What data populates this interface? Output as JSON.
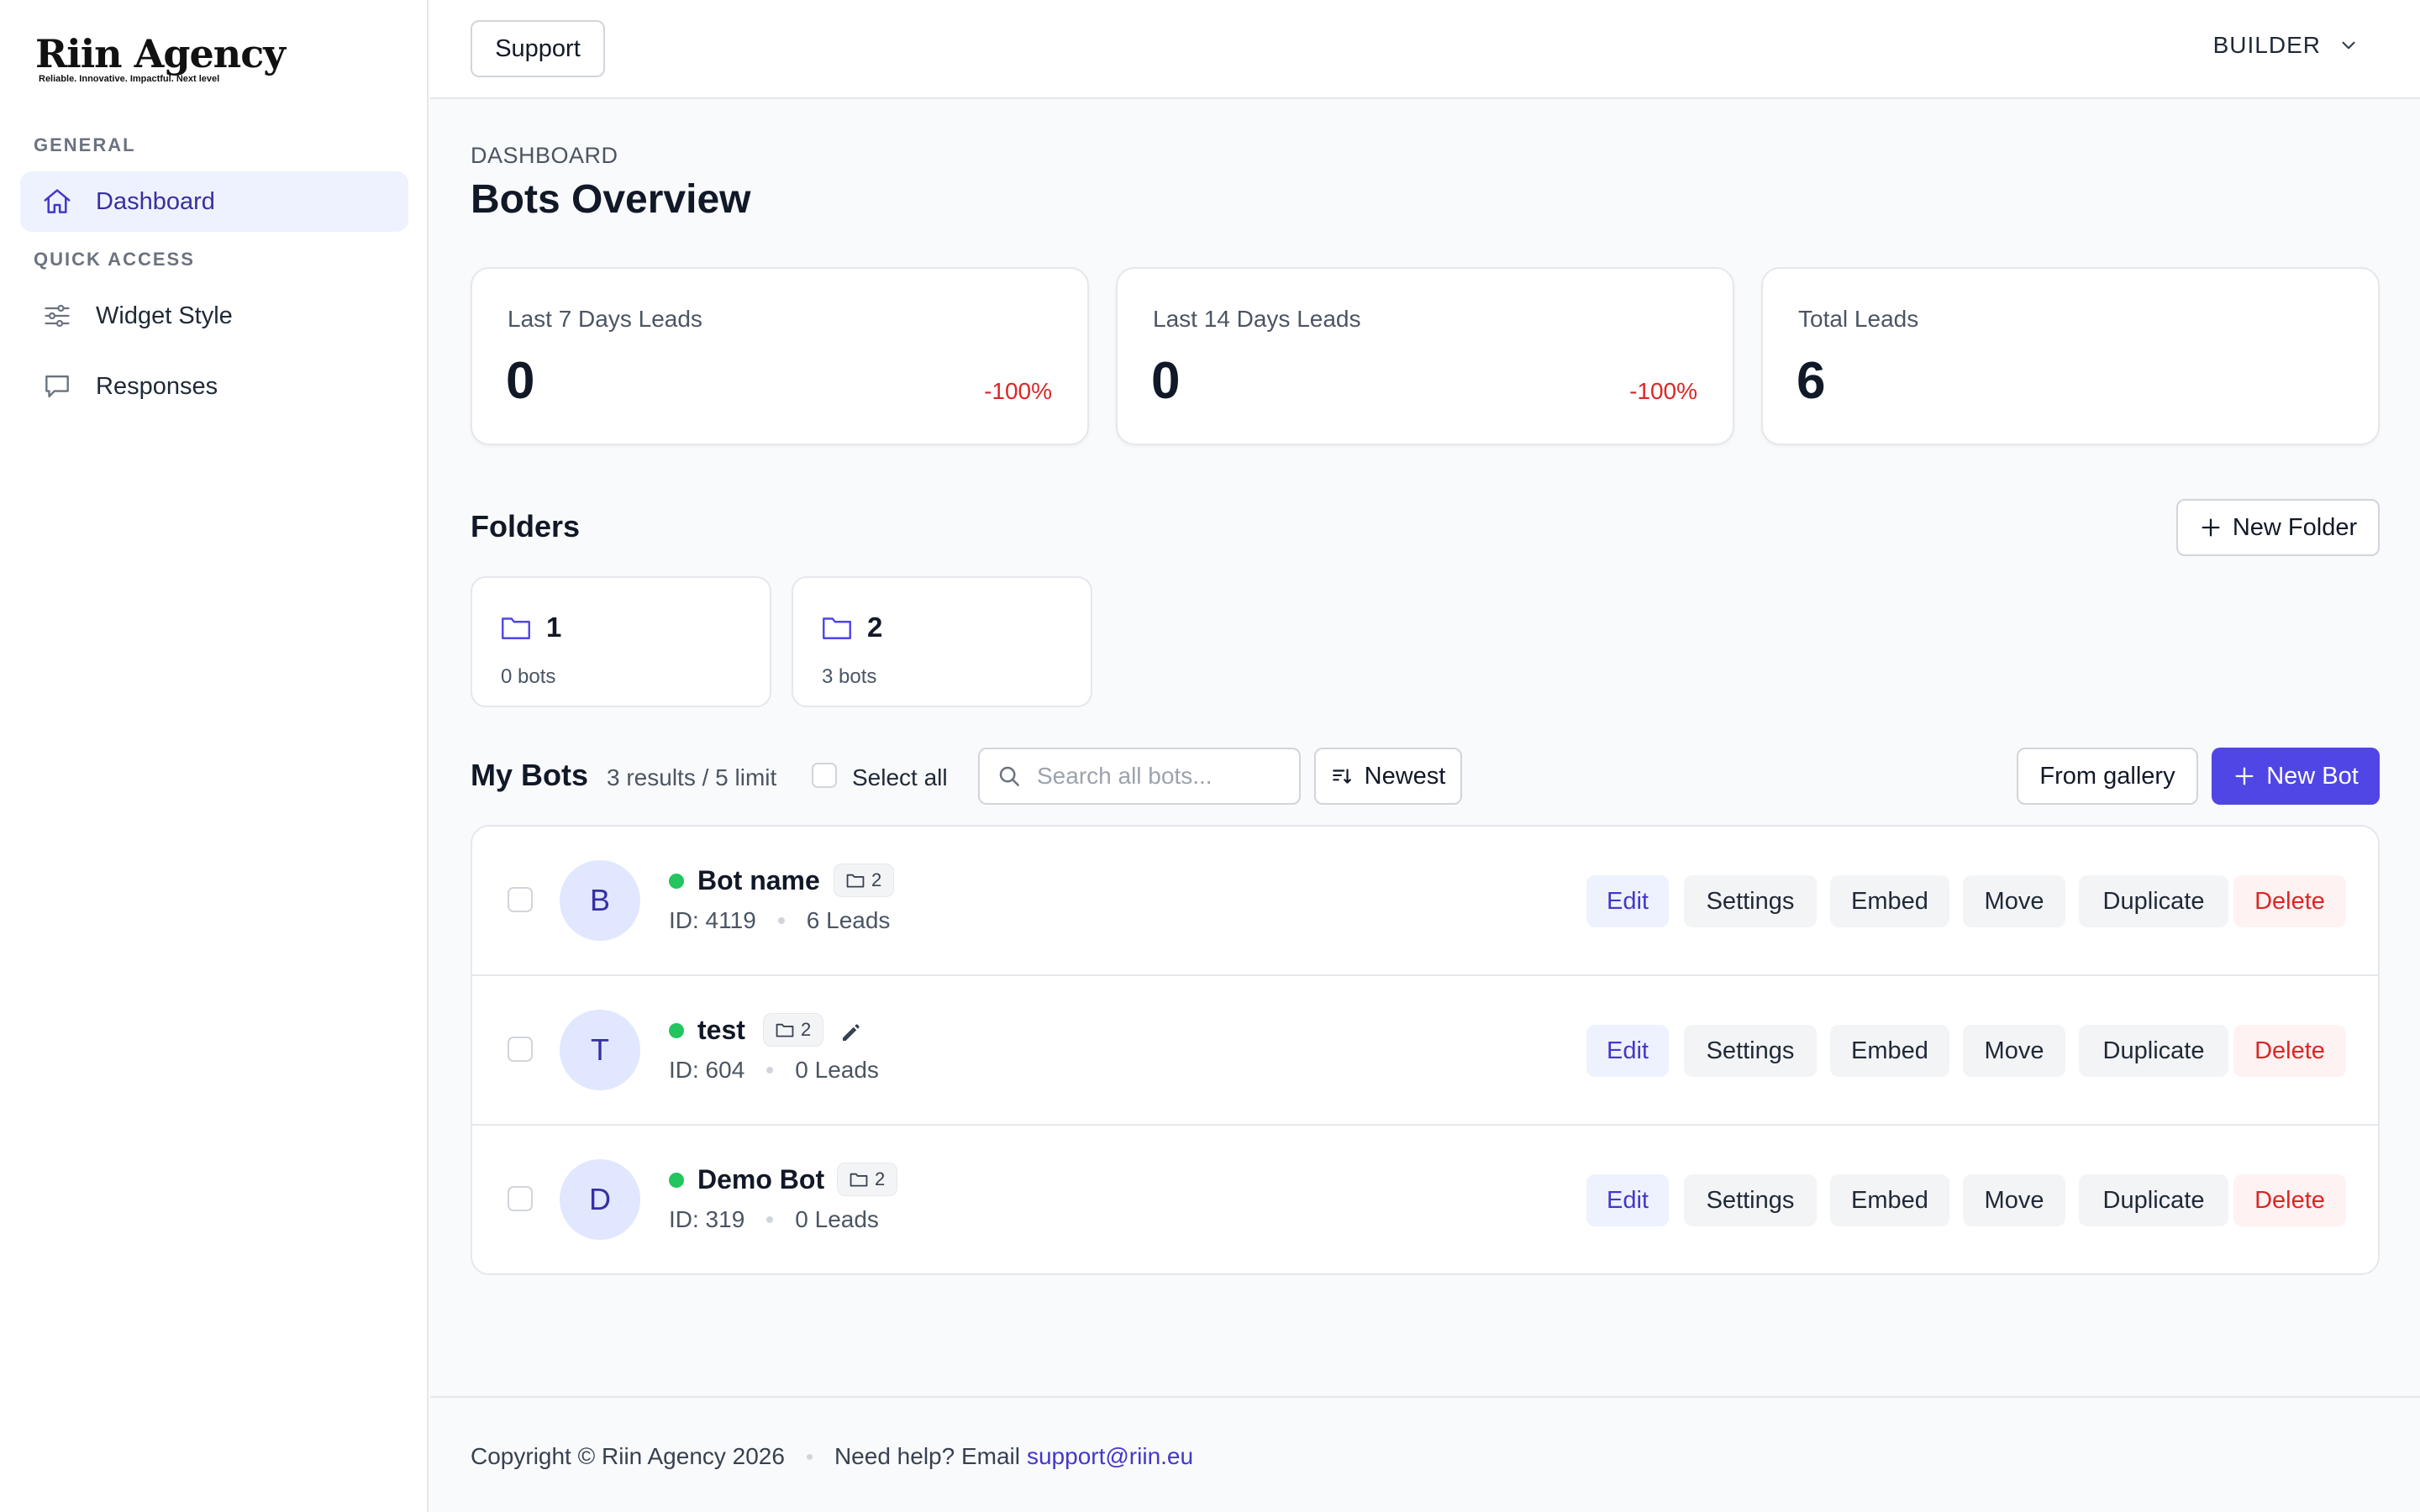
{
  "brand": {
    "name": "Riin Agency",
    "tagline": "Reliable. Innovative. Impactful. Next level"
  },
  "sidebar": {
    "sections": [
      {
        "label": "GENERAL"
      },
      {
        "label": "QUICK ACCESS"
      }
    ],
    "items": [
      {
        "label": "Dashboard",
        "icon": "home-icon",
        "active": true
      },
      {
        "label": "Widget Style",
        "icon": "sliders-icon"
      },
      {
        "label": "Responses",
        "icon": "chat-bubble-icon"
      }
    ]
  },
  "header": {
    "support_label": "Support",
    "role_label": "BUILDER"
  },
  "page": {
    "breadcrumb": "DASHBOARD",
    "title": "Bots Overview"
  },
  "stats": [
    {
      "label": "Last 7 Days Leads",
      "value": "0",
      "change": "-100%"
    },
    {
      "label": "Last 14 Days Leads",
      "value": "0",
      "change": "-100%"
    },
    {
      "label": "Total Leads",
      "value": "6",
      "change": ""
    }
  ],
  "folders": {
    "title": "Folders",
    "new_folder_label": "New Folder",
    "items": [
      {
        "name": "1",
        "count": "0 bots"
      },
      {
        "name": "2",
        "count": "3 bots"
      }
    ]
  },
  "bots": {
    "title": "My Bots",
    "count_text": "3 results / 5 limit",
    "select_all_label": "Select all",
    "search_placeholder": "Search all bots...",
    "sort_label": "Newest",
    "gallery_label": "From gallery",
    "new_bot_label": "New Bot",
    "actions": {
      "edit": "Edit",
      "settings": "Settings",
      "embed": "Embed",
      "move": "Move",
      "duplicate": "Duplicate",
      "delete": "Delete"
    },
    "rows": [
      {
        "initial": "B",
        "name": "Bot name",
        "folder": "2",
        "id": "ID: 4119",
        "leads": "6 Leads"
      },
      {
        "initial": "T",
        "name": "test",
        "folder": "2",
        "id": "ID: 604",
        "leads": "0 Leads"
      },
      {
        "initial": "D",
        "name": "Demo Bot",
        "folder": "2",
        "id": "ID: 319",
        "leads": "0 Leads"
      }
    ]
  },
  "footer": {
    "copyright": "Copyright © Riin Agency 2026",
    "help_text": "Need help? Email",
    "email": "support@riin.eu"
  },
  "colors": {
    "accent": "#4f46e5",
    "active_bg": "#eef2ff",
    "danger": "#dc2626",
    "online": "#22c55e"
  }
}
